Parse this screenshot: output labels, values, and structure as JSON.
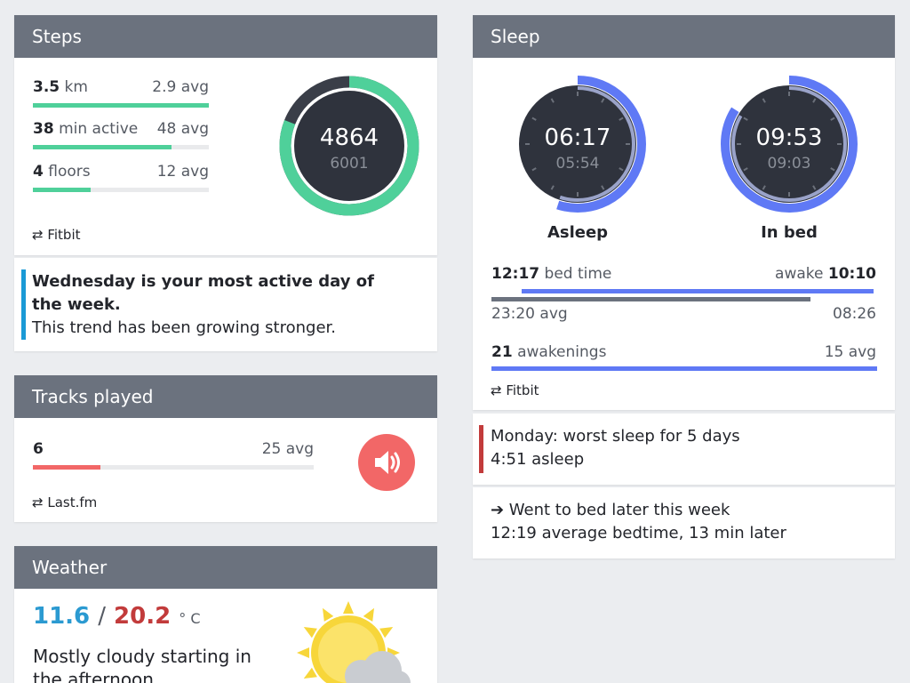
{
  "steps": {
    "title": "Steps",
    "rows": [
      {
        "value": "3.5",
        "unit": "km",
        "avg": "2.9 avg",
        "fill": 1.0
      },
      {
        "value": "38",
        "unit": "min active",
        "avg": "48 avg",
        "fill": 0.79
      },
      {
        "value": "4",
        "unit": "floors",
        "avg": "12 avg",
        "fill": 0.33
      }
    ],
    "gauge_value": "4864",
    "gauge_goal": "6001",
    "gauge_fraction": 0.81,
    "source": "⇄ Fitbit",
    "colors": {
      "fill": "#4fd09a",
      "dial": "#2f333d"
    }
  },
  "steps_insight": {
    "headline": "Wednesday is your most active day of the week.",
    "detail": "This trend has been growing stronger.",
    "color": "#1a9ad6"
  },
  "tracks": {
    "title": "Tracks played",
    "value": "6",
    "avg": "25 avg",
    "fill": 0.24,
    "source": "⇄ Last.fm",
    "colors": {
      "fill": "#f26767",
      "icon_bg": "#f26767"
    },
    "icon": "speaker-icon"
  },
  "weather": {
    "title": "Weather",
    "low": "11.6",
    "sep": "/",
    "high": "20.2",
    "unit": "° C",
    "summary": "Mostly cloudy starting in the afternoon.",
    "icon": "partly-cloudy-icon",
    "colors": {
      "low": "#2b9ad1",
      "high": "#c23b3b",
      "sun": "#f7d63a"
    }
  },
  "sleep": {
    "title": "Sleep",
    "asleep": {
      "time": "06:17",
      "avg": "05:54",
      "label": "Asleep",
      "fraction": 0.55
    },
    "inbed": {
      "time": "09:53",
      "avg": "09:03",
      "label": "In bed",
      "fraction": 0.84
    },
    "bedtime": {
      "value": "12:17",
      "label": "bed time"
    },
    "awake": {
      "label": "awake",
      "value": "10:10"
    },
    "bed_avg": "23:20 avg",
    "awake_avg": "08:26",
    "awakenings": {
      "value": "21",
      "label": "awakenings",
      "avg": "15 avg"
    },
    "source": "⇄ Fitbit",
    "colors": {
      "ring": "#5f79f5",
      "dial": "#2f333d",
      "avg_bar": "#6b727e"
    }
  },
  "sleep_insight_1": {
    "line1": "Monday: worst sleep for 5 days",
    "line2": "4:51 asleep",
    "color": "#c23b3b"
  },
  "sleep_insight_2": {
    "line1": "➔ Went to bed later this week",
    "line2": "12:19 average bedtime, 13 min later"
  }
}
